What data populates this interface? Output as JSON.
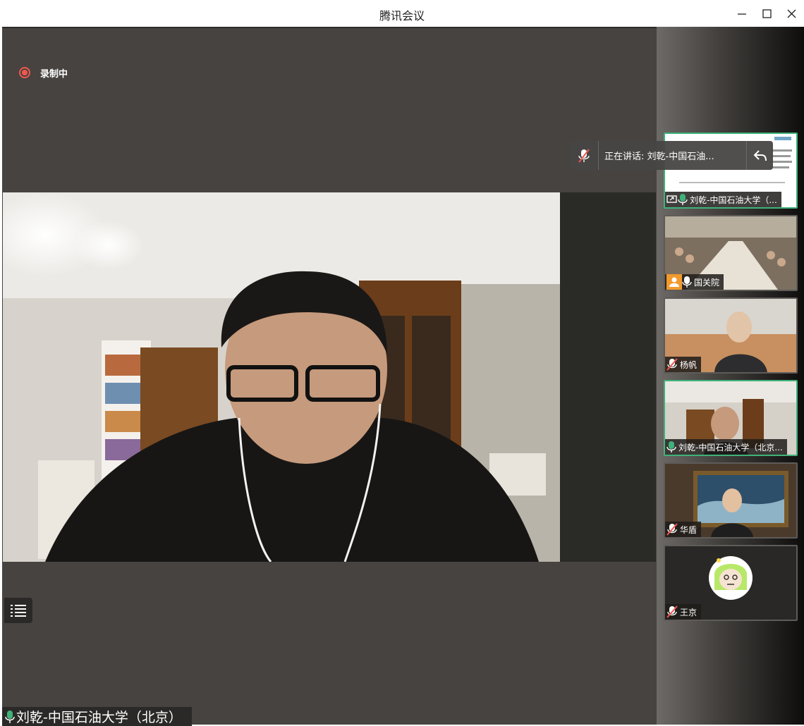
{
  "window": {
    "title": "腾讯会议"
  },
  "colors": {
    "accent_green": "#3fb27a",
    "recording_red": "#f0584f",
    "stage_bg": "#474340"
  },
  "recording": {
    "label": "录制中"
  },
  "speaking_popup": {
    "text": "正在讲话: 刘乾-中国石油..."
  },
  "main_stage": {
    "speaker_name": "刘乾-中国石油大学（北京）"
  },
  "participants": [
    {
      "name": "刘乾-中国石油大学（...",
      "mic": "on",
      "sharing": true,
      "active": true
    },
    {
      "name": "国关院",
      "mic": "on",
      "avatar_badge": true,
      "active": false
    },
    {
      "name": "杨帆",
      "mic": "muted",
      "active": false
    },
    {
      "name": "刘乾-中国石油大学（北京...",
      "mic": "on",
      "active": true
    },
    {
      "name": "华盾",
      "mic": "muted",
      "active": false
    },
    {
      "name": "王京",
      "mic": "muted",
      "avatar": "cartoon",
      "active": false
    }
  ],
  "icons": {
    "minimize": "minimize-icon",
    "maximize": "maximize-icon",
    "close": "close-icon",
    "menu": "list-menu-icon",
    "mic": "microphone-icon",
    "mic_muted": "microphone-muted-icon",
    "back": "reply-arrow-icon",
    "share": "screen-share-icon",
    "avatar": "person-avatar-icon"
  }
}
